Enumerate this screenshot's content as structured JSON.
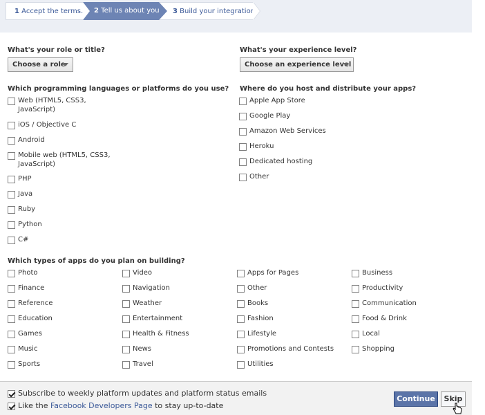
{
  "steps": [
    {
      "num": "1",
      "label": "Accept the terms."
    },
    {
      "num": "2",
      "label": "Tell us about you."
    },
    {
      "num": "3",
      "label": "Build your integration."
    }
  ],
  "role": {
    "question": "What's your role or title?",
    "dropdown": "Choose a role"
  },
  "experience": {
    "question": "What's your experience level?",
    "dropdown": "Choose an experience level"
  },
  "languages": {
    "question": "Which programming languages or platforms do you use?",
    "items": [
      "Web (HTML5, CSS3,\nJavaScript)",
      "iOS / Objective C",
      "Android",
      "Mobile web (HTML5, CSS3,\nJavaScript)",
      "PHP",
      "Java",
      "Ruby",
      "Python",
      "C#"
    ]
  },
  "hosting": {
    "question": "Where do you host and distribute your apps?",
    "items": [
      "Apple App Store",
      "Google Play",
      "Amazon Web Services",
      "Heroku",
      "Dedicated hosting",
      "Other"
    ]
  },
  "app_types": {
    "question": "Which types of apps do you plan on building?",
    "columns": [
      [
        "Photo",
        "Finance",
        "Reference",
        "Education",
        "Games",
        "Music",
        "Sports"
      ],
      [
        "Video",
        "Navigation",
        "Weather",
        "Entertainment",
        "Health & Fitness",
        "News",
        "Travel"
      ],
      [
        "Apps for Pages",
        "Other",
        "Books",
        "Fashion",
        "Lifestyle",
        "Promotions and Contests",
        "Utilities"
      ],
      [
        "Business",
        "Productivity",
        "Communication",
        "Food & Drink",
        "Local",
        "Shopping"
      ]
    ]
  },
  "footer": {
    "subscribe_label": "Subscribe to weekly platform updates and platform status emails",
    "subscribe_checked": true,
    "like_prefix": "Like the ",
    "like_link": "Facebook Developers Page",
    "like_suffix": " to stay up-to-date",
    "like_checked": true,
    "continue_label": "Continue",
    "skip_label": "Skip"
  },
  "colors": {
    "accent": "#3b5998",
    "active_step": "#6d84b4",
    "header_bg": "#eceff5"
  }
}
